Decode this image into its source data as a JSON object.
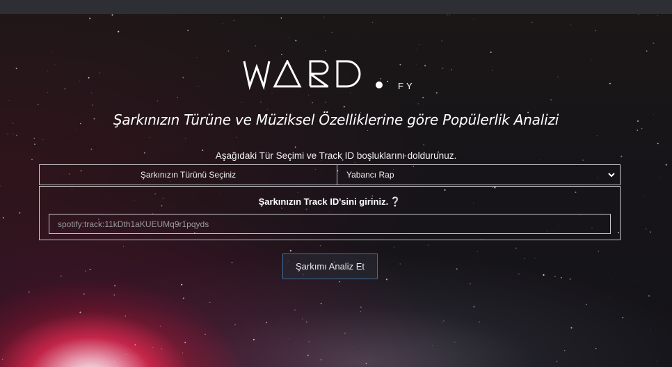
{
  "logo": {
    "main": "WARD",
    "suffix": "FY"
  },
  "heading": "Şarkınızın Türüne ve Müziksel Özelliklerine göre Popülerlik Analizi",
  "instruction": "Aşağıdaki Tür Seçimi ve Track ID boşluklarını doldurunuz.",
  "genre": {
    "label": "Şarkınızın Türünü Seçiniz",
    "selected": "Yabancı Rap",
    "icon": "chevron-down-icon"
  },
  "track": {
    "title": "Şarkınızın Track ID'sini giriniz.",
    "help_icon": "❔",
    "placeholder": "spotify:track:11kDth1aKUEUMq9r1pqyds",
    "value": ""
  },
  "analyze_button": "Şarkımı Analiz Et",
  "colors": {
    "top_bar": "#2e2f35",
    "border": "#c9c9cc",
    "button_border": "#3f6e9c"
  }
}
